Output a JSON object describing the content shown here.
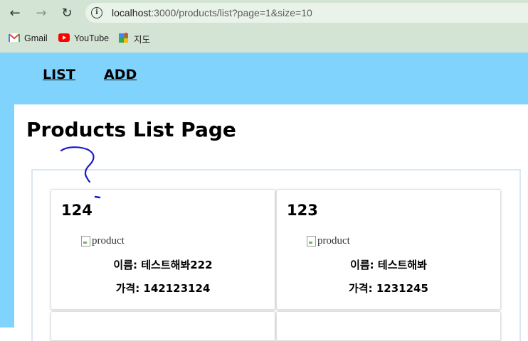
{
  "browser": {
    "url_host": "localhost",
    "url_rest": ":3000/products/list?page=1&size=10",
    "bookmarks": [
      {
        "label": "Gmail",
        "icon": "gmail-icon"
      },
      {
        "label": "YouTube",
        "icon": "youtube-icon"
      },
      {
        "label": "지도",
        "icon": "maps-icon"
      }
    ]
  },
  "nav": {
    "list_label": "LIST",
    "add_label": "ADD"
  },
  "page": {
    "title": "Products List Page"
  },
  "products": [
    {
      "id": "124",
      "img_alt": "product",
      "name_line": "이름: 테스트해봐222",
      "price_line": "가격: 142123124"
    },
    {
      "id": "123",
      "img_alt": "product",
      "name_line": "이름: 테스트해봐",
      "price_line": "가격: 1231245"
    }
  ],
  "colors": {
    "header_bg": "#7fd3fc",
    "browser_chrome": "#d3e3d4",
    "annotation_ink": "#1a1acc"
  }
}
